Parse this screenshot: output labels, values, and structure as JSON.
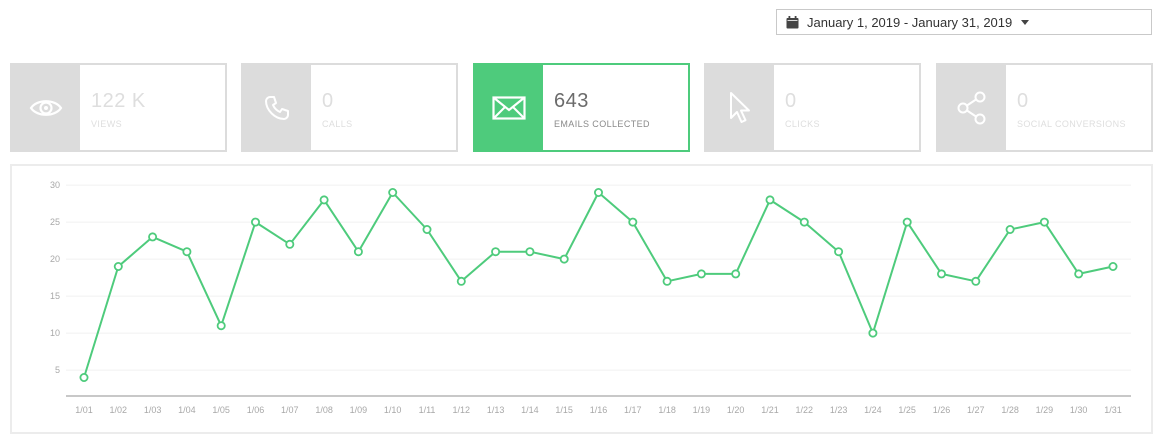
{
  "date_range": {
    "label": "January 1, 2019 - January 31, 2019",
    "icon": "calendar-icon"
  },
  "cards": [
    {
      "value": "122 K",
      "label": "VIEWS",
      "icon": "eye-icon",
      "active": false
    },
    {
      "value": "0",
      "label": "CALLS",
      "icon": "phone-icon",
      "active": false
    },
    {
      "value": "643",
      "label": "EMAILS COLLECTED",
      "icon": "envelope-icon",
      "active": true
    },
    {
      "value": "0",
      "label": "CLICKS",
      "icon": "cursor-icon",
      "active": false
    },
    {
      "value": "0",
      "label": "SOCIAL CONVERSIONS",
      "icon": "share-icon",
      "active": false
    }
  ],
  "colors": {
    "accent": "#4ecb7c",
    "inactive": "#dcdcdc"
  },
  "chart_data": {
    "type": "line",
    "x": [
      "1/01",
      "1/02",
      "1/03",
      "1/04",
      "1/05",
      "1/06",
      "1/07",
      "1/08",
      "1/09",
      "1/10",
      "1/11",
      "1/12",
      "1/13",
      "1/14",
      "1/15",
      "1/16",
      "1/17",
      "1/18",
      "1/19",
      "1/20",
      "1/21",
      "1/22",
      "1/23",
      "1/24",
      "1/25",
      "1/26",
      "1/27",
      "1/28",
      "1/29",
      "1/30",
      "1/31"
    ],
    "series": [
      {
        "values": [
          4,
          19,
          23,
          21,
          11,
          25,
          22,
          28,
          21,
          29,
          24,
          17,
          21,
          21,
          20,
          29,
          25,
          17,
          18,
          18,
          28,
          25,
          21,
          10,
          25,
          18,
          17,
          24,
          25,
          18,
          19
        ]
      }
    ],
    "yticks": [
      5,
      10,
      15,
      20,
      25,
      30
    ],
    "ylim": [
      1.5,
      31.5
    ],
    "grid": true,
    "color": "#4ecb7c"
  }
}
